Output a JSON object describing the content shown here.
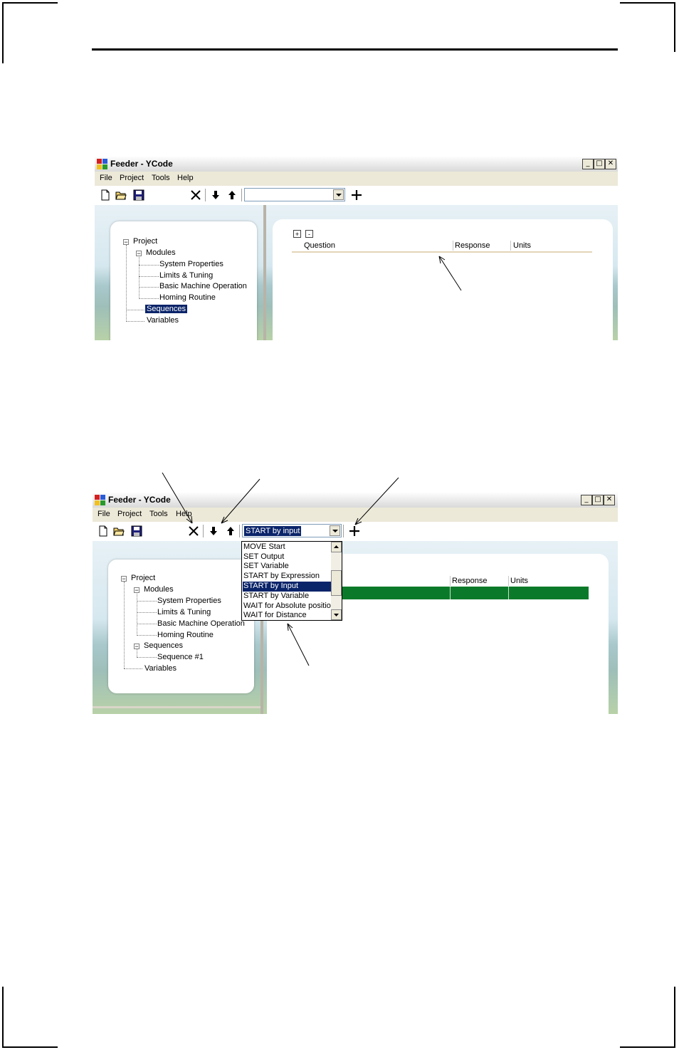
{
  "screenshot1": {
    "window_title": "Feeder - YCode",
    "window_buttons": [
      "_",
      "□",
      "✕"
    ],
    "menu": [
      "File",
      "Project",
      "Tools",
      "Help"
    ],
    "combo_value": "",
    "tree": {
      "root": "Project",
      "modules": "Modules",
      "module_items": [
        "System Properties",
        "Limits & Tuning",
        "Basic Machine Operation",
        "Homing Routine"
      ],
      "sequences": "Sequences",
      "variables": "Variables"
    },
    "grid": {
      "expand_btn": "+",
      "collapse_btn": "-",
      "columns": [
        "Question",
        "Response",
        "Units"
      ]
    }
  },
  "screenshot2": {
    "window_title": "Feeder - YCode",
    "window_buttons": [
      "_",
      "□",
      "✕"
    ],
    "menu": [
      "File",
      "Project",
      "Tools",
      "Help"
    ],
    "combo_value": "START by input",
    "dropdown_items": [
      "MOVE Start",
      "SET Output",
      "SET Variable",
      "START by Expression",
      "START by Input",
      "START by Variable",
      "WAIT for Absolute positio",
      "WAIT for Distance"
    ],
    "dropdown_selected_index": 4,
    "tree": {
      "root": "Project",
      "modules": "Modules",
      "module_items": [
        "System Properties",
        "Limits & Tuning",
        "Basic Machine Operation",
        "Homing Routine"
      ],
      "sequences": "Sequences",
      "sequence_items": [
        "Sequence #1"
      ],
      "variables": "Variables"
    },
    "grid": {
      "columns": [
        "Response",
        "Units"
      ],
      "row_color": "#0a7a2a"
    }
  },
  "icons": [
    "new-file-icon",
    "open-folder-icon",
    "save-icon",
    "delete-icon",
    "move-down-icon",
    "move-up-icon",
    "add-icon"
  ]
}
